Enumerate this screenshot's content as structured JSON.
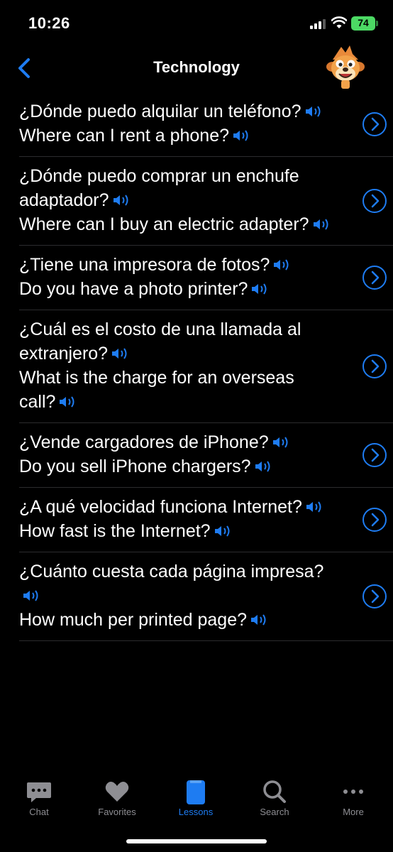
{
  "status": {
    "time": "10:26",
    "battery": "74"
  },
  "nav": {
    "title": "Technology"
  },
  "items": [
    {
      "es": "¿Dónde puedo alquilar un teléfono?",
      "en": "Where can I rent a phone?"
    },
    {
      "es": "¿Dónde puedo comprar un enchufe adaptador?",
      "en": "Where can I buy an electric adapter?"
    },
    {
      "es": "¿Tiene una impresora de fotos?",
      "en": "Do you have a photo printer?"
    },
    {
      "es": "¿Cuál es el costo de una llamada al extranjero?",
      "en": "What is the charge for an overseas call?"
    },
    {
      "es": "¿Vende cargadores de iPhone?",
      "en": "Do you sell iPhone chargers?"
    },
    {
      "es": "¿A qué velocidad funciona Internet?",
      "en": "How fast is the Internet?"
    },
    {
      "es": "¿Cuánto cuesta cada página impresa?",
      "en": "How much per printed page?"
    }
  ],
  "tabs": [
    {
      "label": "Chat",
      "icon": "chat-bubble-icon"
    },
    {
      "label": "Favorites",
      "icon": "heart-icon"
    },
    {
      "label": "Lessons",
      "icon": "book-icon",
      "active": true
    },
    {
      "label": "Search",
      "icon": "search-icon"
    },
    {
      "label": "More",
      "icon": "ellipsis-icon"
    }
  ],
  "colors": {
    "accent": "#1e7cf2",
    "background": "#000000",
    "inactive": "#8e8e93",
    "battery": "#4cd964"
  }
}
